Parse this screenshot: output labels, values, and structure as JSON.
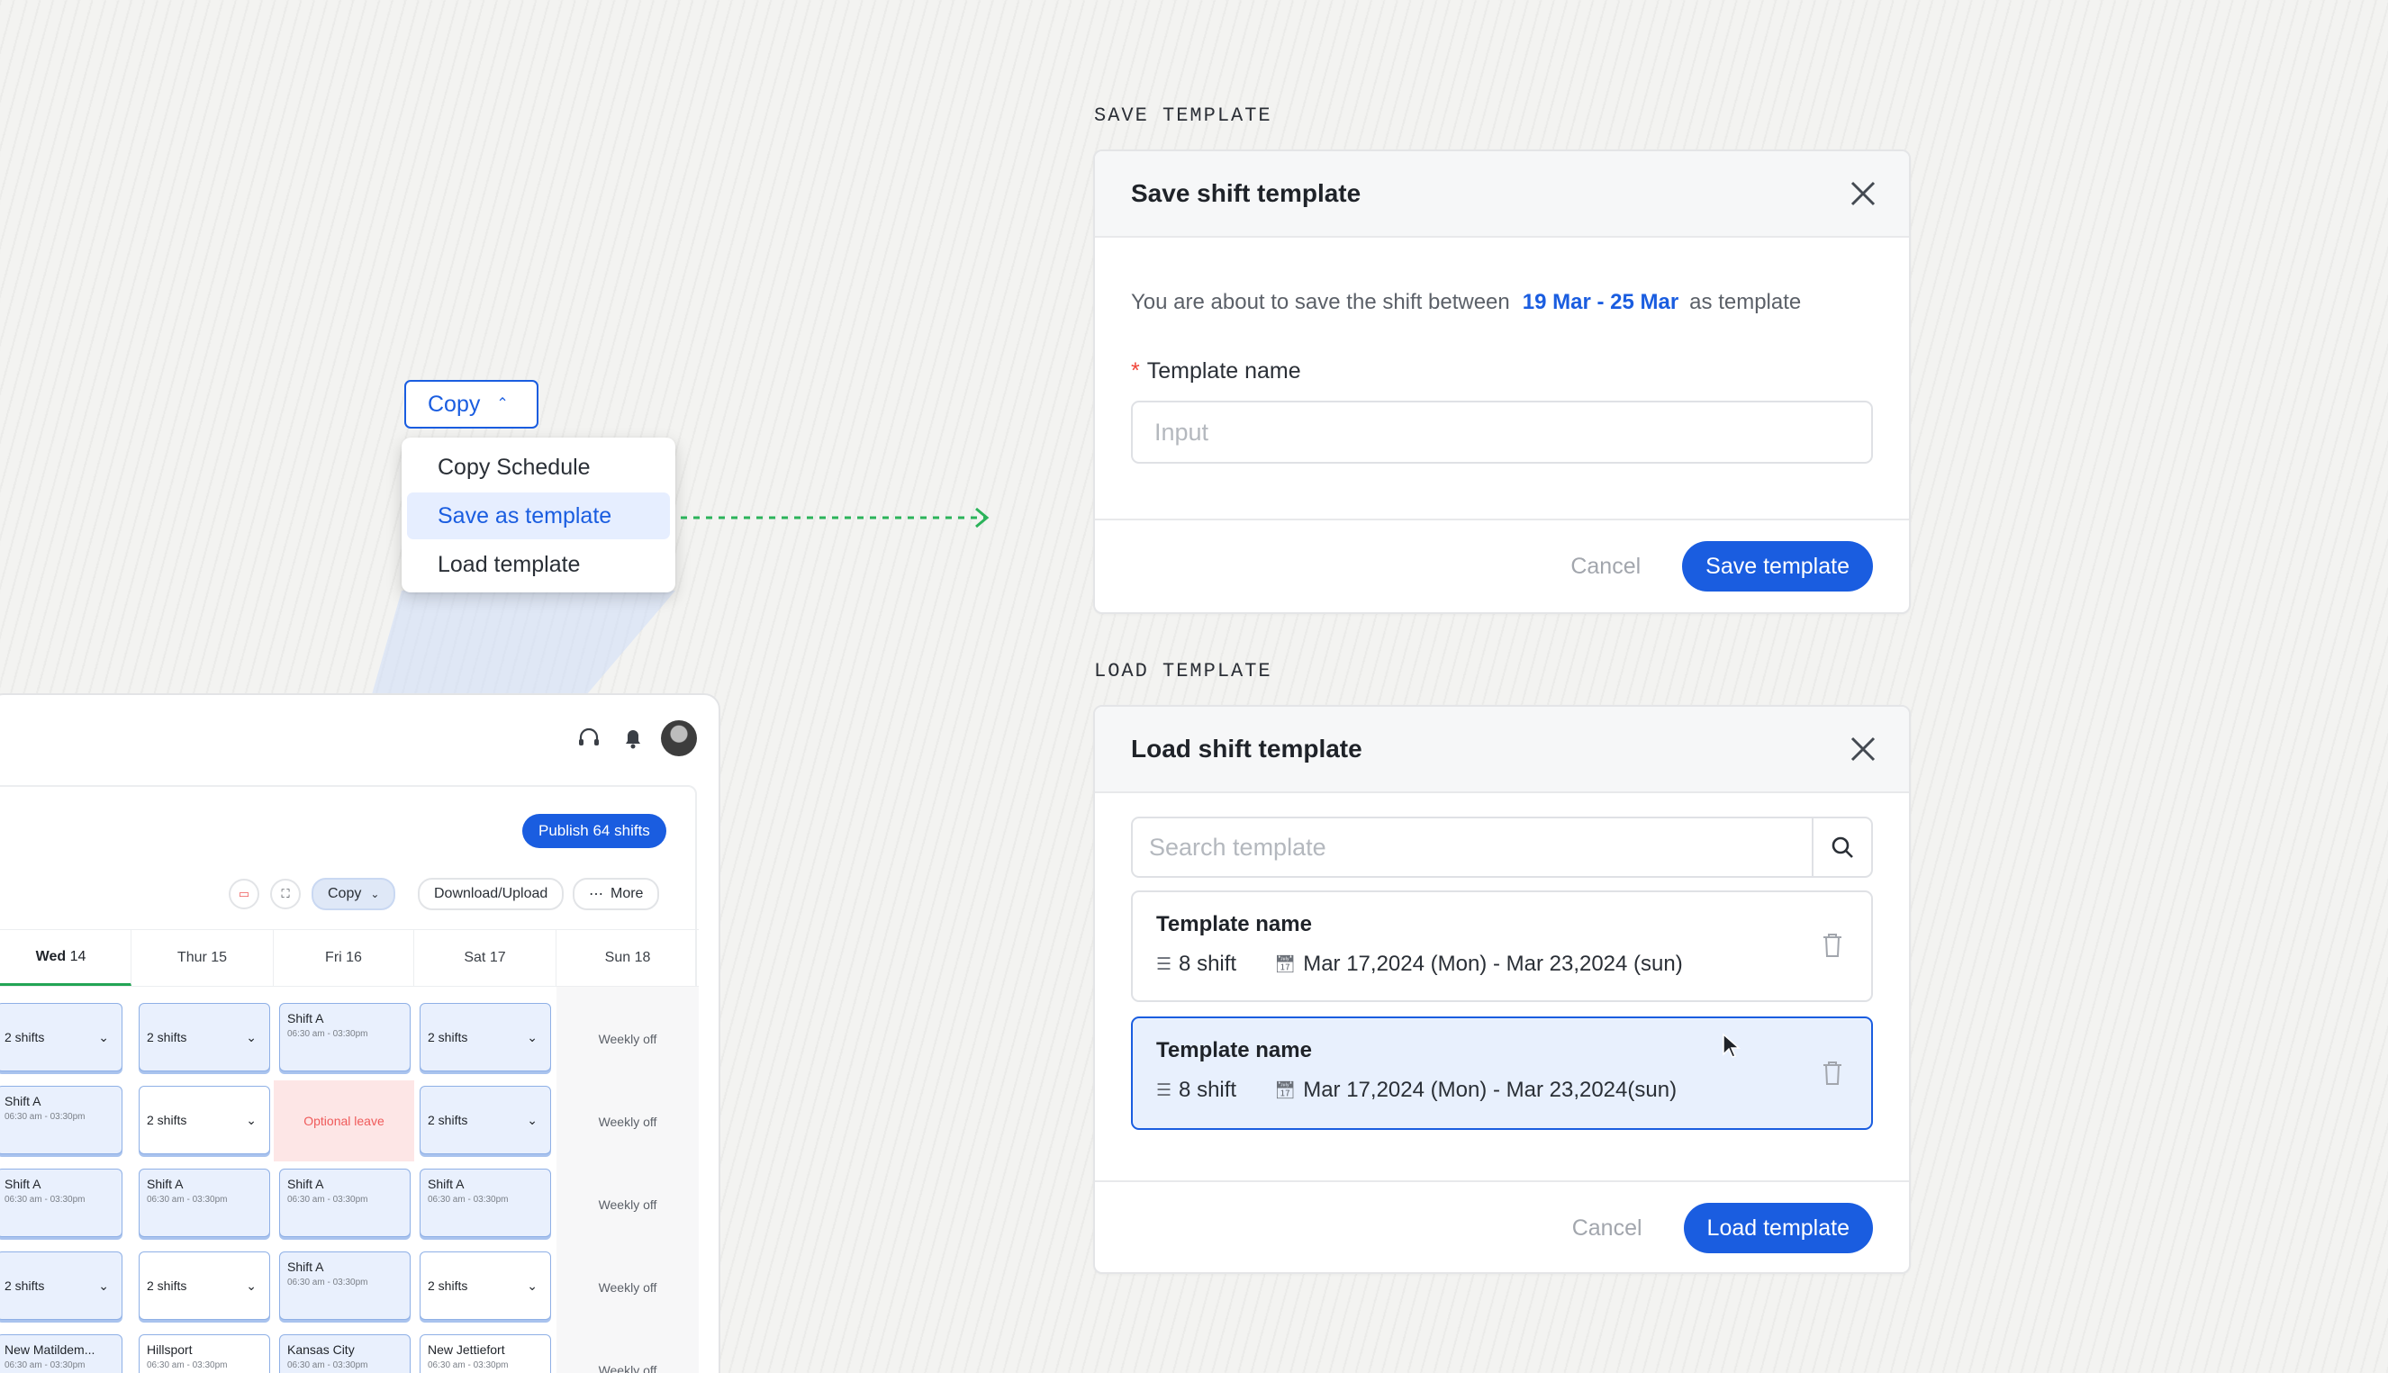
{
  "dropdown": {
    "trigger_label": "Copy",
    "items": [
      "Copy Schedule",
      "Save as template",
      "Load template"
    ],
    "active_index": 1
  },
  "save_section": {
    "label": "SAVE TEMPLATE",
    "title": "Save shift template",
    "description_prefix": "You are about to save the shift between",
    "date_range": "19 Mar - 25 Mar",
    "description_suffix": "as template",
    "field_label": "Template name",
    "input_placeholder": "Input",
    "cancel_label": "Cancel",
    "submit_label": "Save template"
  },
  "load_section": {
    "label": "LOAD TEMPLATE",
    "title": "Load shift template",
    "search_placeholder": "Search template",
    "templates": [
      {
        "name": "Template name",
        "shifts": "8 shift",
        "range": "Mar 17,2024 (Mon) - Mar 23,2024 (sun)",
        "selected": false
      },
      {
        "name": "Template name",
        "shifts": "8 shift",
        "range": "Mar 17,2024 (Mon) - Mar 23,2024(sun)",
        "selected": true
      }
    ],
    "cancel_label": "Cancel",
    "submit_label": "Load template"
  },
  "schedule": {
    "publish_label": "Publish 64 shifts",
    "toolbar": {
      "copy": "Copy",
      "download": "Download/Upload",
      "more": "More"
    },
    "days": [
      {
        "name": "Wed",
        "num": "14"
      },
      {
        "name": "Thur",
        "num": "15"
      },
      {
        "name": "Fri",
        "num": "16"
      },
      {
        "name": "Sat",
        "num": "17"
      },
      {
        "name": "Sun",
        "num": "18"
      }
    ],
    "texts": {
      "two_shifts": "2 shifts",
      "shift_a": "Shift A",
      "time": "06:30 am - 03:30pm",
      "optional_leave": "Optional leave",
      "weekly_off": "Weekly off",
      "loc1": "New Matildem...",
      "loc2": "Hillsport",
      "loc3": "Kansas City",
      "loc4": "New Jettiefort"
    }
  },
  "colors": {
    "accent": "#1a5de0",
    "arrow": "#2bb35a",
    "leave": "#ef5a5a"
  }
}
